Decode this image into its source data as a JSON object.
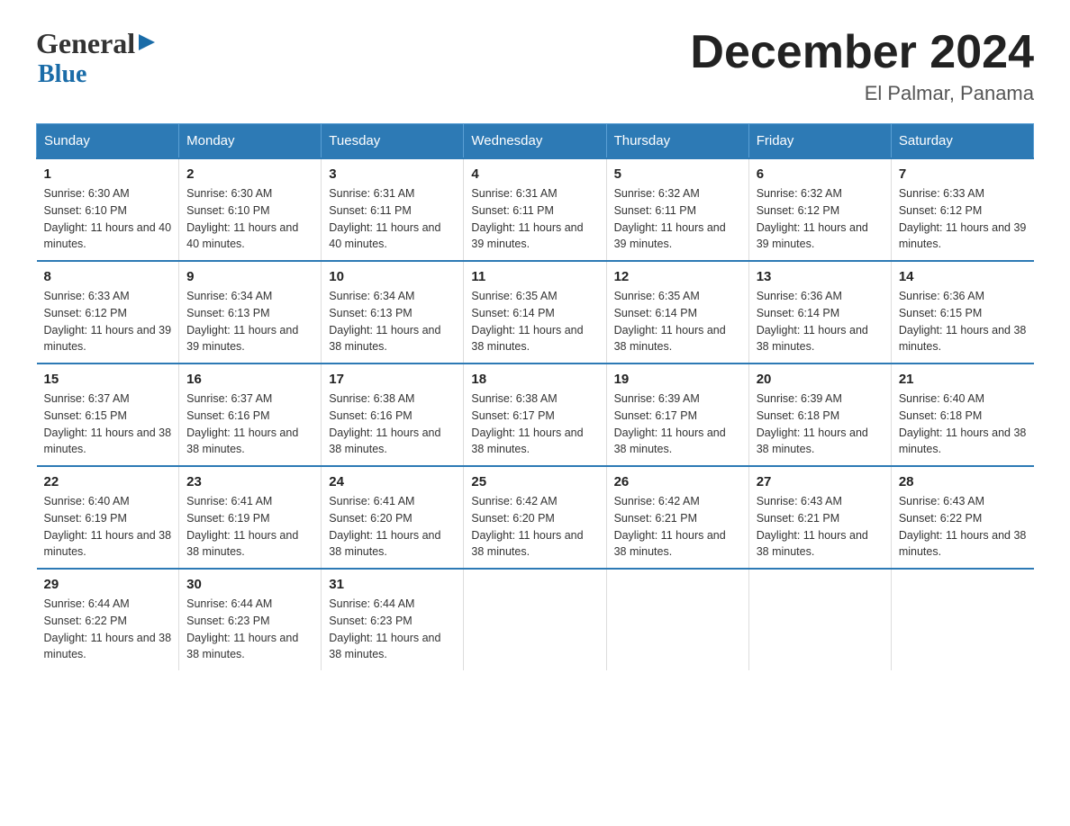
{
  "logo": {
    "general": "General",
    "blue": "Blue",
    "arrow": "▶"
  },
  "title": "December 2024",
  "location": "El Palmar, Panama",
  "days_of_week": [
    "Sunday",
    "Monday",
    "Tuesday",
    "Wednesday",
    "Thursday",
    "Friday",
    "Saturday"
  ],
  "weeks": [
    [
      {
        "num": "1",
        "sunrise": "6:30 AM",
        "sunset": "6:10 PM",
        "daylight": "11 hours and 40 minutes."
      },
      {
        "num": "2",
        "sunrise": "6:30 AM",
        "sunset": "6:10 PM",
        "daylight": "11 hours and 40 minutes."
      },
      {
        "num": "3",
        "sunrise": "6:31 AM",
        "sunset": "6:11 PM",
        "daylight": "11 hours and 40 minutes."
      },
      {
        "num": "4",
        "sunrise": "6:31 AM",
        "sunset": "6:11 PM",
        "daylight": "11 hours and 39 minutes."
      },
      {
        "num": "5",
        "sunrise": "6:32 AM",
        "sunset": "6:11 PM",
        "daylight": "11 hours and 39 minutes."
      },
      {
        "num": "6",
        "sunrise": "6:32 AM",
        "sunset": "6:12 PM",
        "daylight": "11 hours and 39 minutes."
      },
      {
        "num": "7",
        "sunrise": "6:33 AM",
        "sunset": "6:12 PM",
        "daylight": "11 hours and 39 minutes."
      }
    ],
    [
      {
        "num": "8",
        "sunrise": "6:33 AM",
        "sunset": "6:12 PM",
        "daylight": "11 hours and 39 minutes."
      },
      {
        "num": "9",
        "sunrise": "6:34 AM",
        "sunset": "6:13 PM",
        "daylight": "11 hours and 39 minutes."
      },
      {
        "num": "10",
        "sunrise": "6:34 AM",
        "sunset": "6:13 PM",
        "daylight": "11 hours and 38 minutes."
      },
      {
        "num": "11",
        "sunrise": "6:35 AM",
        "sunset": "6:14 PM",
        "daylight": "11 hours and 38 minutes."
      },
      {
        "num": "12",
        "sunrise": "6:35 AM",
        "sunset": "6:14 PM",
        "daylight": "11 hours and 38 minutes."
      },
      {
        "num": "13",
        "sunrise": "6:36 AM",
        "sunset": "6:14 PM",
        "daylight": "11 hours and 38 minutes."
      },
      {
        "num": "14",
        "sunrise": "6:36 AM",
        "sunset": "6:15 PM",
        "daylight": "11 hours and 38 minutes."
      }
    ],
    [
      {
        "num": "15",
        "sunrise": "6:37 AM",
        "sunset": "6:15 PM",
        "daylight": "11 hours and 38 minutes."
      },
      {
        "num": "16",
        "sunrise": "6:37 AM",
        "sunset": "6:16 PM",
        "daylight": "11 hours and 38 minutes."
      },
      {
        "num": "17",
        "sunrise": "6:38 AM",
        "sunset": "6:16 PM",
        "daylight": "11 hours and 38 minutes."
      },
      {
        "num": "18",
        "sunrise": "6:38 AM",
        "sunset": "6:17 PM",
        "daylight": "11 hours and 38 minutes."
      },
      {
        "num": "19",
        "sunrise": "6:39 AM",
        "sunset": "6:17 PM",
        "daylight": "11 hours and 38 minutes."
      },
      {
        "num": "20",
        "sunrise": "6:39 AM",
        "sunset": "6:18 PM",
        "daylight": "11 hours and 38 minutes."
      },
      {
        "num": "21",
        "sunrise": "6:40 AM",
        "sunset": "6:18 PM",
        "daylight": "11 hours and 38 minutes."
      }
    ],
    [
      {
        "num": "22",
        "sunrise": "6:40 AM",
        "sunset": "6:19 PM",
        "daylight": "11 hours and 38 minutes."
      },
      {
        "num": "23",
        "sunrise": "6:41 AM",
        "sunset": "6:19 PM",
        "daylight": "11 hours and 38 minutes."
      },
      {
        "num": "24",
        "sunrise": "6:41 AM",
        "sunset": "6:20 PM",
        "daylight": "11 hours and 38 minutes."
      },
      {
        "num": "25",
        "sunrise": "6:42 AM",
        "sunset": "6:20 PM",
        "daylight": "11 hours and 38 minutes."
      },
      {
        "num": "26",
        "sunrise": "6:42 AM",
        "sunset": "6:21 PM",
        "daylight": "11 hours and 38 minutes."
      },
      {
        "num": "27",
        "sunrise": "6:43 AM",
        "sunset": "6:21 PM",
        "daylight": "11 hours and 38 minutes."
      },
      {
        "num": "28",
        "sunrise": "6:43 AM",
        "sunset": "6:22 PM",
        "daylight": "11 hours and 38 minutes."
      }
    ],
    [
      {
        "num": "29",
        "sunrise": "6:44 AM",
        "sunset": "6:22 PM",
        "daylight": "11 hours and 38 minutes."
      },
      {
        "num": "30",
        "sunrise": "6:44 AM",
        "sunset": "6:23 PM",
        "daylight": "11 hours and 38 minutes."
      },
      {
        "num": "31",
        "sunrise": "6:44 AM",
        "sunset": "6:23 PM",
        "daylight": "11 hours and 38 minutes."
      },
      null,
      null,
      null,
      null
    ]
  ],
  "labels": {
    "sunrise": "Sunrise:",
    "sunset": "Sunset:",
    "daylight": "Daylight:"
  }
}
